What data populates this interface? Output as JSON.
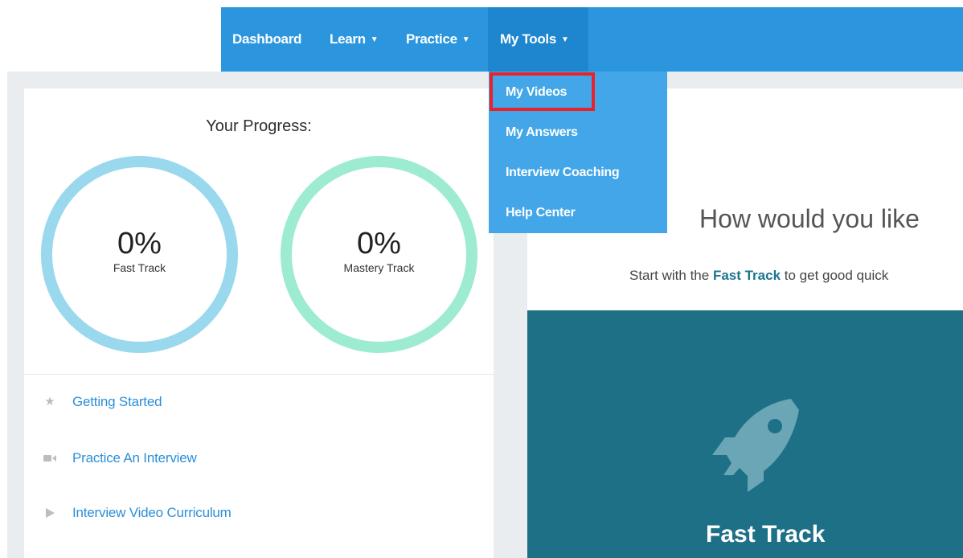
{
  "nav": {
    "items": [
      {
        "label": "Dashboard",
        "has_caret": false
      },
      {
        "label": "Learn",
        "has_caret": true
      },
      {
        "label": "Practice",
        "has_caret": true
      },
      {
        "label": "My Tools",
        "has_caret": true
      }
    ],
    "active": "My Tools",
    "color": "#2b96de"
  },
  "dropdown": {
    "items": [
      "My Videos",
      "My Answers",
      "Interview Coaching",
      "Help Center"
    ],
    "highlighted": "My Videos",
    "highlight_color": "#e8222a"
  },
  "progress": {
    "title": "Your Progress:",
    "tracks": [
      {
        "percent": "0%",
        "label": "Fast Track",
        "color": "#9ad8ee"
      },
      {
        "percent": "0%",
        "label": "Mastery Track",
        "color": "#9debd0"
      }
    ]
  },
  "links": [
    {
      "icon": "star-icon",
      "label": "Getting Started"
    },
    {
      "icon": "video-camera-icon",
      "label": "Practice An Interview"
    },
    {
      "icon": "play-icon",
      "label": "Interview Video Curriculum"
    }
  ],
  "main": {
    "headline": "How would you like",
    "subline_prefix": "Start with the ",
    "subline_bold": "Fast Track",
    "subline_suffix": " to get good quick",
    "card": {
      "title": "Fast Track",
      "icon": "rocket-icon",
      "color": "#1e7087"
    }
  }
}
